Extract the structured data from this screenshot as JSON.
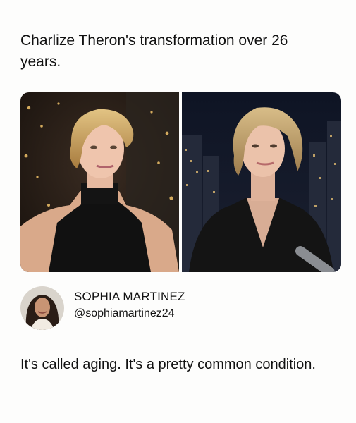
{
  "post": {
    "caption": "Charlize Theron's transformation over 26 years."
  },
  "author": {
    "name": "SOPHIA MARTINEZ",
    "handle": "@sophiamartinez24"
  },
  "reply": {
    "text": "It's called aging. It's a pretty common condition."
  }
}
